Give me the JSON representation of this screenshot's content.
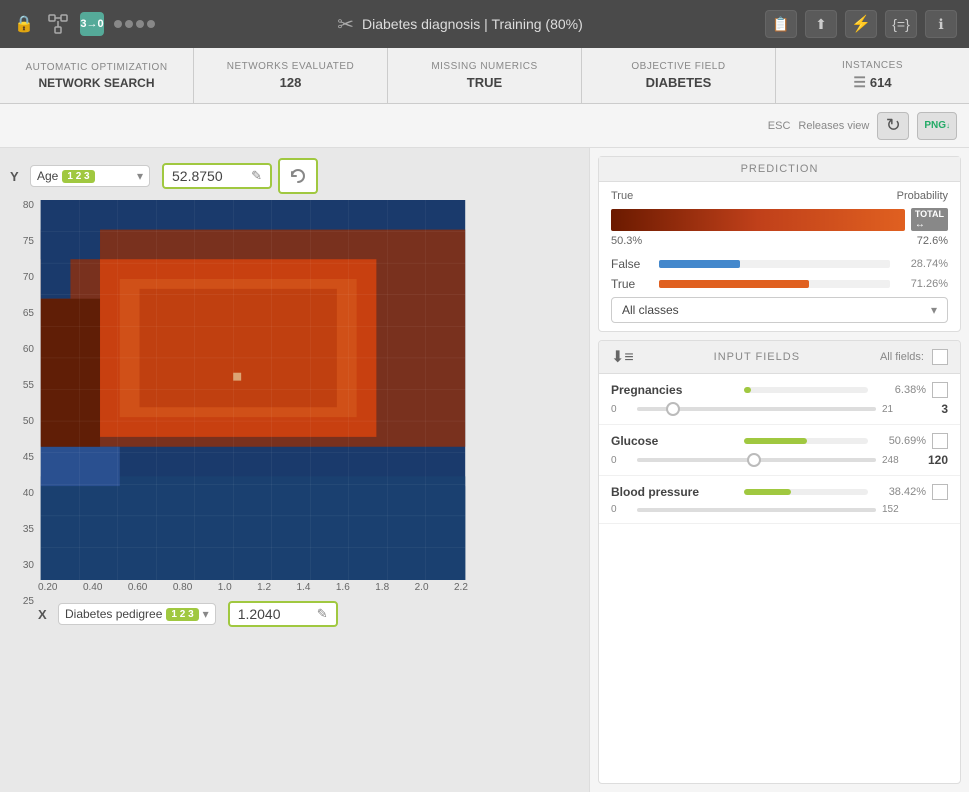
{
  "topbar": {
    "title": "Diabetes diagnosis | Training (80%)",
    "lock_icon": "🔒",
    "network_icon": "⬡",
    "dots_icon": "••••",
    "actions": [
      "📋",
      "⬆",
      "⚡",
      "{=}",
      "ℹ"
    ]
  },
  "stats": [
    {
      "label": "AUTOMATIC OPTIMIZATION",
      "value": "NETWORK SEARCH"
    },
    {
      "label": "NETWORKS EVALUATED",
      "value": "128"
    },
    {
      "label": "MISSING NUMERICS",
      "value": "TRUE"
    },
    {
      "label": "OBJECTIVE FIELD",
      "value": "DIABETES"
    },
    {
      "label": "INSTANCES",
      "value": "614",
      "has_icon": true
    }
  ],
  "toolbar": {
    "esc_hint": "ESC",
    "releases_view": "Releases view",
    "refresh_icon": "↻",
    "png_label": "PNG"
  },
  "chart": {
    "y_axis": {
      "label": "Y",
      "field": "Age",
      "badge": "1 2 3",
      "value": "52.8750",
      "labels": [
        "80",
        "75",
        "70",
        "65",
        "60",
        "55",
        "50",
        "45",
        "40",
        "35",
        "30",
        "25"
      ]
    },
    "x_axis": {
      "label": "X",
      "field": "Diabetes pedigree",
      "badge": "1 2 3",
      "value": "1.2040",
      "labels": [
        "0.20",
        "0.40",
        "0.60",
        "0.80",
        "1.0",
        "1.2",
        "1.4",
        "1.6",
        "1.8",
        "2.0",
        "2.2"
      ]
    }
  },
  "prediction": {
    "header": "PREDICTION",
    "col_true": "True",
    "col_probability": "Probability",
    "main_pct_left": "50.3%",
    "main_pct_right": "72.6%",
    "total_label": "TOTAL",
    "rows": [
      {
        "label": "False",
        "bar_color": "#4488cc",
        "bar_pct": "35%",
        "pct": "28.74%"
      },
      {
        "label": "True",
        "bar_color": "#e06020",
        "bar_pct": "65%",
        "pct": "71.26%"
      }
    ],
    "dropdown": "All classes"
  },
  "input_fields": {
    "header": "INPUT FIELDS",
    "all_fields_label": "All fields:",
    "fields": [
      {
        "name": "Pregnancies",
        "pct": "6.38%",
        "bar_color": "#a0c840",
        "bar_width": "6%",
        "min": "0",
        "max": "21",
        "thumb_pos": "13%",
        "value": "3"
      },
      {
        "name": "Glucose",
        "pct": "50.69%",
        "bar_color": "#a0c840",
        "bar_width": "51%",
        "min": "0",
        "max": "248",
        "thumb_pos": "47%",
        "value": "120"
      },
      {
        "name": "Blood pressure",
        "pct": "38.42%",
        "bar_color": "#a0c840",
        "bar_width": "38%",
        "min": "0",
        "max": "152",
        "thumb_pos": "N/A",
        "value": ""
      }
    ]
  }
}
